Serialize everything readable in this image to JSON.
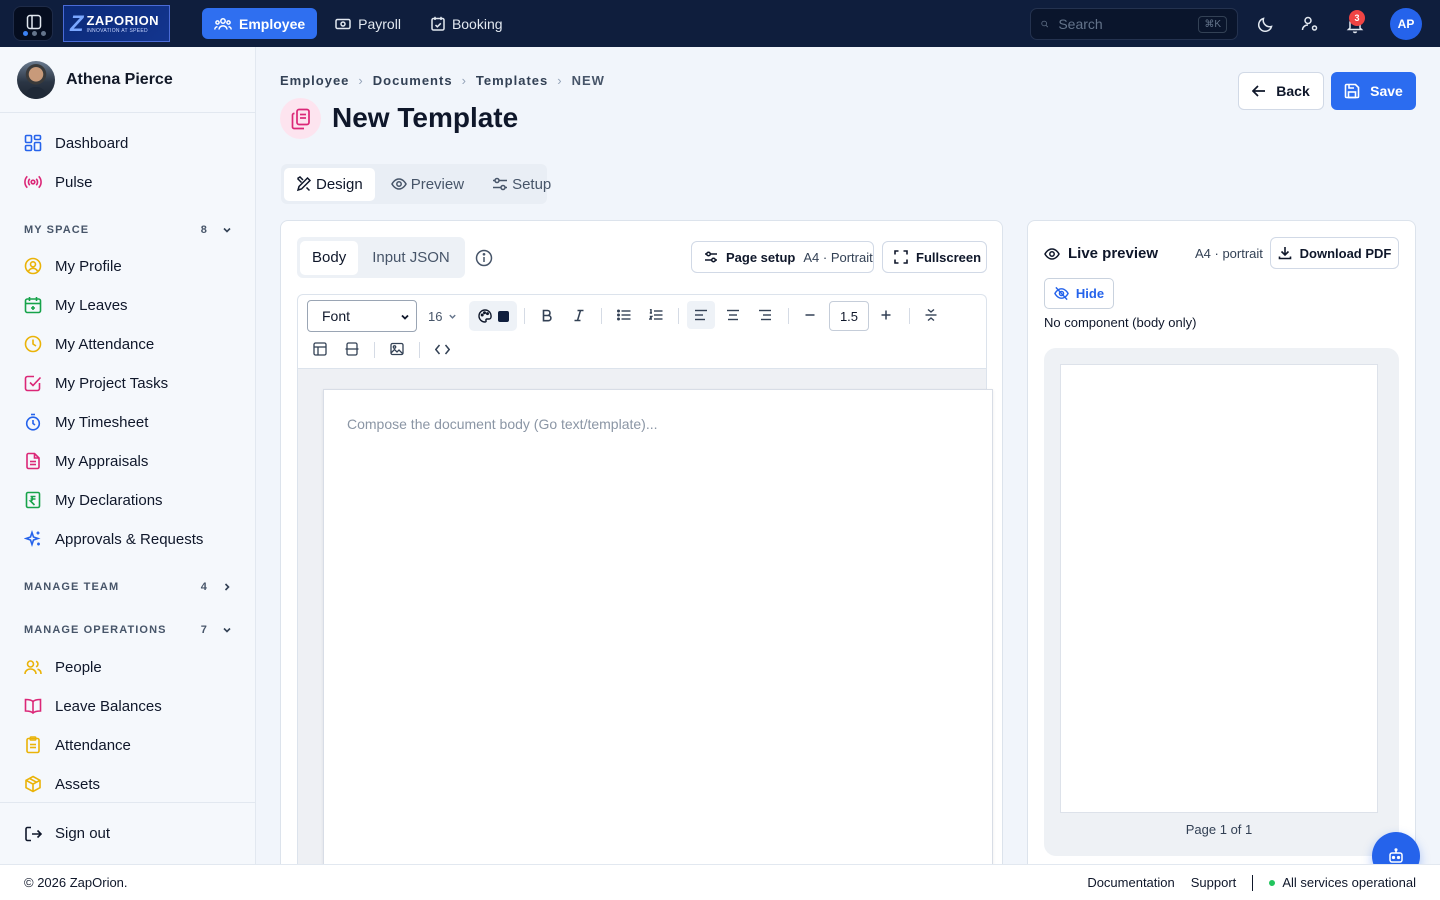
{
  "topbar": {
    "logo": {
      "name": "ZAPORION",
      "tagline": "INNOVATION AT SPEED"
    },
    "nav": [
      {
        "label": "Employee",
        "icon": "team-icon",
        "active": true
      },
      {
        "label": "Payroll",
        "icon": "cash-icon",
        "active": false
      },
      {
        "label": "Booking",
        "icon": "calendar-check-icon",
        "active": false
      }
    ],
    "search": {
      "placeholder": "Search",
      "shortcut": "⌘K"
    },
    "notifications_count": "3",
    "avatar_initials": "AP"
  },
  "sidebar": {
    "user_name": "Athena Pierce",
    "top_items": [
      {
        "label": "Dashboard",
        "icon": "dashboard-icon"
      },
      {
        "label": "Pulse",
        "icon": "broadcast-icon"
      }
    ],
    "sections": {
      "my_space": {
        "label": "MY SPACE",
        "count": "8",
        "expanded": true
      },
      "manage_team": {
        "label": "MANAGE TEAM",
        "count": "4",
        "expanded": false
      },
      "manage_operations": {
        "label": "MANAGE OPERATIONS",
        "count": "7",
        "expanded": true
      }
    },
    "my_space_items": [
      {
        "label": "My Profile",
        "icon": "profile-icon"
      },
      {
        "label": "My Leaves",
        "icon": "calendar-plus-icon"
      },
      {
        "label": "My Attendance",
        "icon": "clock-icon"
      },
      {
        "label": "My Project Tasks",
        "icon": "checkbox-icon"
      },
      {
        "label": "My Timesheet",
        "icon": "stopwatch-icon"
      },
      {
        "label": "My Appraisals",
        "icon": "document-icon"
      },
      {
        "label": "My Declarations",
        "icon": "rupee-receipt-icon"
      },
      {
        "label": "Approvals & Requests",
        "icon": "sparkle-icon"
      }
    ],
    "operations_items": [
      {
        "label": "People",
        "icon": "people-icon"
      },
      {
        "label": "Leave Balances",
        "icon": "book-icon"
      },
      {
        "label": "Attendance",
        "icon": "clipboard-icon"
      },
      {
        "label": "Assets",
        "icon": "box-icon"
      }
    ],
    "signout_label": "Sign out"
  },
  "breadcrumb": [
    "Employee",
    "Documents",
    "Templates",
    "NEW"
  ],
  "page_title": "New Template",
  "actions": {
    "back": "Back",
    "save": "Save"
  },
  "tabs": [
    "Design",
    "Preview",
    "Setup"
  ],
  "editor": {
    "subtabs": [
      "Body",
      "Input JSON"
    ],
    "page_setup_label": "Page setup",
    "page_setup_value": "A4 · Portrait",
    "fullscreen_label": "Fullscreen",
    "font_value": "Font",
    "font_size": "16",
    "line_height": "1.5",
    "text_color": "#0f1e3d",
    "placeholder": "Compose the document body (Go text/template)..."
  },
  "preview": {
    "title": "Live preview",
    "size": "A4 · portrait",
    "download_label": "Download PDF",
    "hide_label": "Hide",
    "note": "No component (body only)",
    "page_label": "Page 1 of 1"
  },
  "footer": {
    "copyright": "© 2026 ZapOrion.",
    "documentation": "Documentation",
    "support": "Support",
    "status": "All services operational"
  }
}
